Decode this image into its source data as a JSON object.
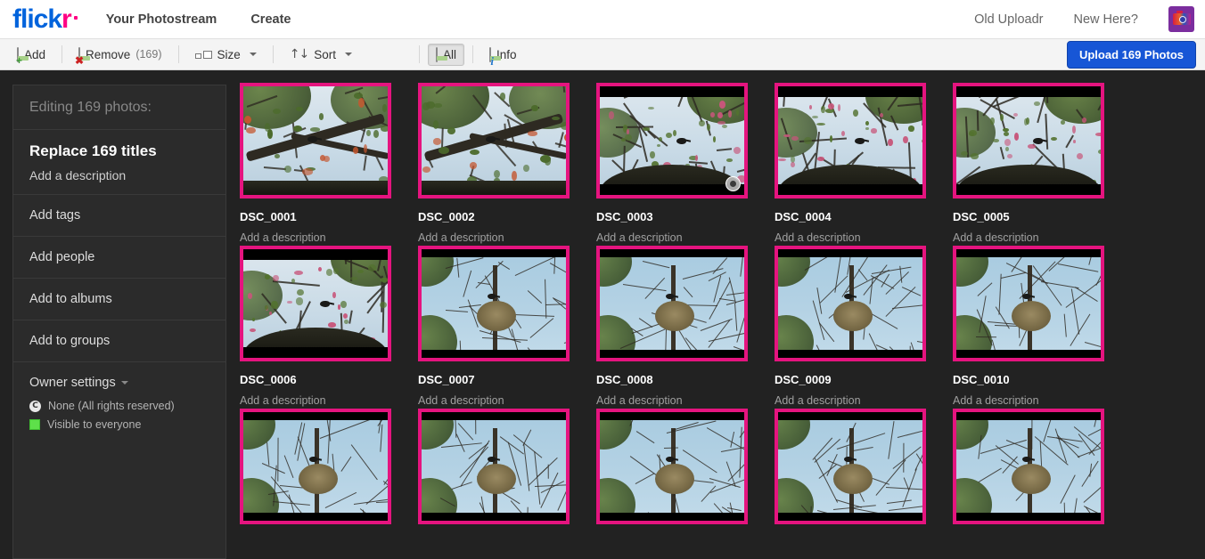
{
  "header": {
    "logo": {
      "part1": "flick",
      "part2": "r"
    },
    "nav_left": [
      {
        "label": "Your Photostream",
        "name": "nav-your-photostream"
      },
      {
        "label": "Create",
        "name": "nav-create"
      }
    ],
    "nav_right": [
      {
        "label": "Old Uploadr",
        "name": "nav-old-uploadr"
      },
      {
        "label": "New Here?",
        "name": "nav-new-here"
      }
    ],
    "avatar_icon": "camera-avatar-icon"
  },
  "toolbar": {
    "add_label": "Add",
    "add_icon": "photo-add-icon",
    "remove_label": "Remove",
    "remove_count": "(169)",
    "remove_icon": "photo-remove-icon",
    "size_label": "Size",
    "size_icon": "size-rectangles-icon",
    "sort_label": "Sort",
    "sort_icon": "sort-arrows-icon",
    "all_label": "All",
    "all_icon": "photo-icon",
    "info_label": "Info",
    "info_icon": "photo-info-icon",
    "upload_label": "Upload 169 Photos",
    "upload_color": "#1756d6"
  },
  "sidebar": {
    "heading": "Editing 169 photos:",
    "batch_title": "Replace 169 titles",
    "batch_subtitle": "Add a description",
    "items": [
      {
        "label": "Add tags",
        "name": "sidebar-item-add-tags"
      },
      {
        "label": "Add people",
        "name": "sidebar-item-add-people"
      },
      {
        "label": "Add to albums",
        "name": "sidebar-item-add-to-albums"
      },
      {
        "label": "Add to groups",
        "name": "sidebar-item-add-to-groups"
      }
    ],
    "owner_settings": {
      "title": "Owner settings",
      "license": "None (All rights reserved)",
      "license_icon": "copyright-icon",
      "visibility": "Visible to everyone",
      "visibility_icon": "green-square-icon",
      "visibility_color": "#5ee04a"
    }
  },
  "grid": {
    "border_color": "#e5147f",
    "description_placeholder": "Add a description",
    "rows": [
      [
        {
          "title": "DSC_0001",
          "desc": "Add a description",
          "scene": "branch-pale",
          "badge": false
        },
        {
          "title": "DSC_0002",
          "desc": "Add a description",
          "scene": "branch-pale",
          "badge": false
        },
        {
          "title": "DSC_0003",
          "desc": "Add a description",
          "scene": "blossom-pale",
          "badge": true
        },
        {
          "title": "DSC_0004",
          "desc": "Add a description",
          "scene": "blossom-pale",
          "badge": false
        },
        {
          "title": "DSC_0005",
          "desc": "Add a description",
          "scene": "blossom-pale",
          "badge": false
        }
      ],
      [
        {
          "title": "DSC_0006",
          "desc": "Add a description",
          "scene": "blossom-pale",
          "badge": false
        },
        {
          "title": "DSC_0007",
          "desc": "Add a description",
          "scene": "nest-blue",
          "badge": false
        },
        {
          "title": "DSC_0008",
          "desc": "Add a description",
          "scene": "nest-blue",
          "badge": false
        },
        {
          "title": "DSC_0009",
          "desc": "Add a description",
          "scene": "nest-blue",
          "badge": false
        },
        {
          "title": "DSC_0010",
          "desc": "Add a description",
          "scene": "nest-blue",
          "badge": false
        }
      ],
      [
        {
          "title": "",
          "desc": "",
          "scene": "nest-blue",
          "badge": false
        },
        {
          "title": "",
          "desc": "",
          "scene": "nest-blue",
          "badge": false
        },
        {
          "title": "",
          "desc": "",
          "scene": "nest-blue",
          "badge": false
        },
        {
          "title": "",
          "desc": "",
          "scene": "nest-blue",
          "badge": false
        },
        {
          "title": "",
          "desc": "",
          "scene": "nest-blue",
          "badge": false
        }
      ]
    ]
  }
}
